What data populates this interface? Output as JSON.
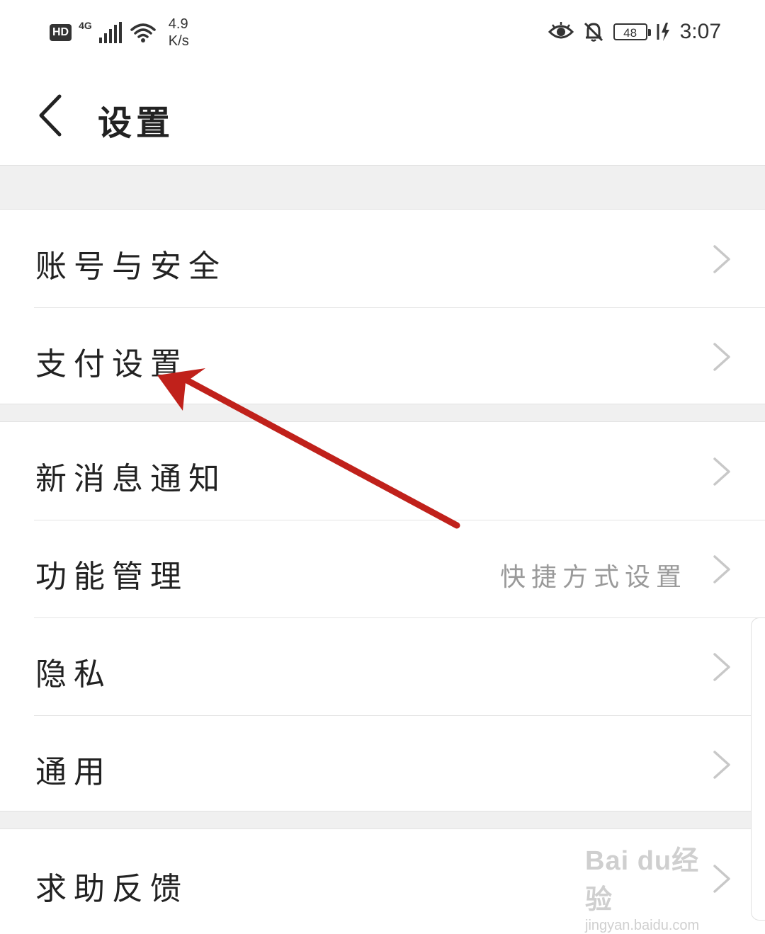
{
  "status_bar": {
    "hd": "HD",
    "network": "4G",
    "speed_value": "4.9",
    "speed_unit": "K/s",
    "battery": "48",
    "time": "3:07",
    "icons": [
      "eye-comfort-icon",
      "bell-off-icon",
      "charging-icon"
    ]
  },
  "header": {
    "title": "设置",
    "back_icon": "chevron-left-icon"
  },
  "groups": [
    {
      "items": [
        {
          "label": "账号与安全",
          "value": ""
        },
        {
          "label": "支付设置",
          "value": ""
        }
      ]
    },
    {
      "items": [
        {
          "label": "新消息通知",
          "value": ""
        },
        {
          "label": "功能管理",
          "value": "快捷方式设置"
        },
        {
          "label": "隐私",
          "value": ""
        },
        {
          "label": "通用",
          "value": ""
        }
      ]
    },
    {
      "items": [
        {
          "label": "求助反馈",
          "value": ""
        }
      ]
    }
  ],
  "annotation": {
    "arrow_color": "#c0211b",
    "points_to": "支付设置"
  },
  "watermark": {
    "main": "Bai du经验",
    "sub": "jingyan.baidu.com"
  }
}
